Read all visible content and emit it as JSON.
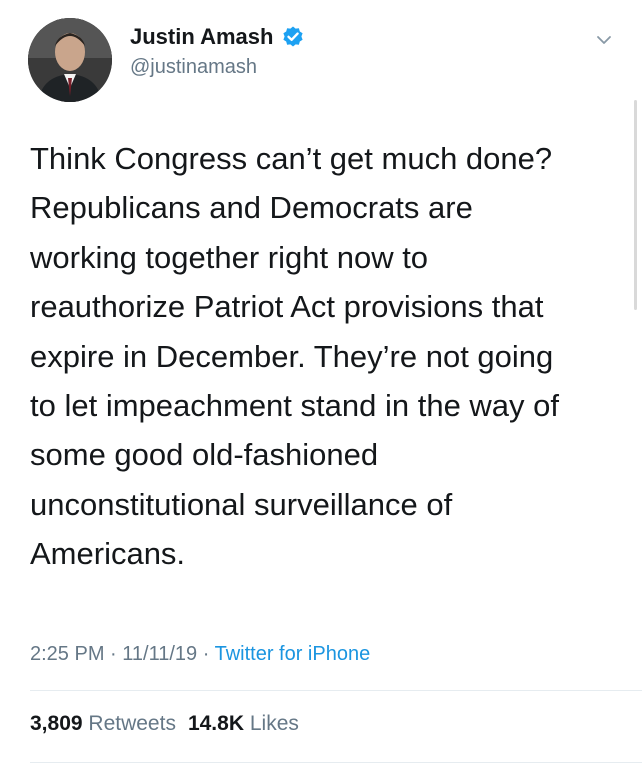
{
  "author": {
    "display_name": "Justin Amash",
    "handle": "@justinamash",
    "verified": true,
    "avatar_icon": "profile-photo"
  },
  "tweet": {
    "lines": [
      "Think Congress can’t get much done?",
      "Republicans and Democrats are",
      "working together right now to",
      "reauthorize Patriot Act provisions that",
      "expire in December. They’re not going",
      "to let impeachment stand in the way of",
      "some good old-fashioned",
      "unconstitutional surveillance of",
      "Americans."
    ]
  },
  "meta": {
    "time": "2:25 PM",
    "sep1": " · ",
    "date": "11/11/19",
    "sep2": " · ",
    "source": "Twitter for iPhone"
  },
  "stats": {
    "retweets_count": "3,809",
    "retweets_label": "Retweets",
    "likes_count": "14.8K",
    "likes_label": "Likes"
  },
  "icons": {
    "verified": "verified-badge-icon",
    "menu": "chevron-down-icon"
  },
  "colors": {
    "text": "#14171a",
    "secondary": "#657786",
    "link": "#1b95e0",
    "verified": "#1da1f2",
    "divider": "#e6ecf0"
  }
}
